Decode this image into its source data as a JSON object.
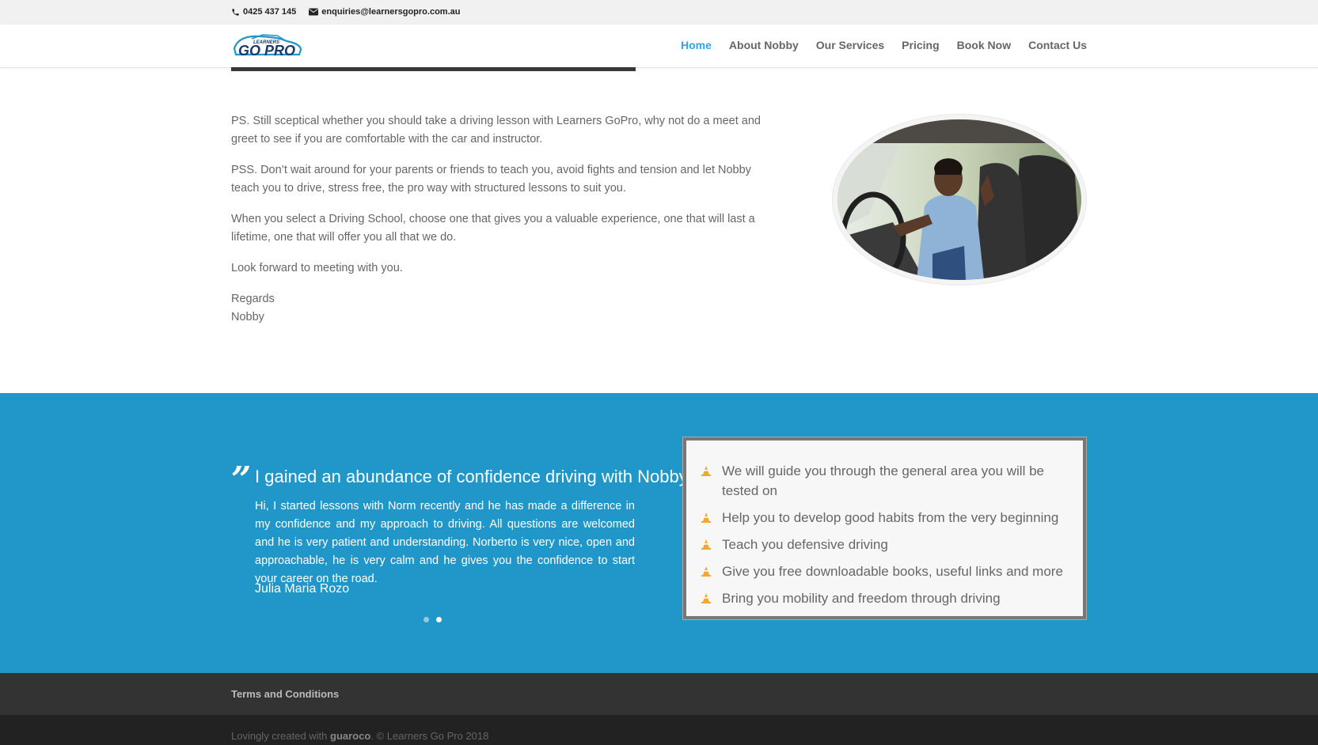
{
  "topbar": {
    "phone": "0425 437 145",
    "email": "enquiries@learnersgopro.com.au"
  },
  "logo": {
    "top_text": "LEARNERS",
    "main_text": "GO PRO"
  },
  "nav": {
    "items": [
      "Home",
      "About Nobby",
      "Our Services",
      "Pricing",
      "Book Now",
      "Contact Us"
    ],
    "active": "Home"
  },
  "content": {
    "p1": "PS. Still sceptical whether you should take a driving lesson with Learners GoPro, why not do a meet and greet to see if you are comfortable with the car and instructor.",
    "p2": "PSS. Don’t wait around for your parents or friends to teach you, avoid fights and tension and let Nobby teach you to drive, stress free, the pro way with structured lessons to suit you.",
    "p3": "When you select a Driving School, choose one that gives you a valuable experience, one that will last a lifetime, one that will offer you all that we do.",
    "p4": "Look forward to meeting with you.",
    "regards": "Regards",
    "name": "Nobby"
  },
  "testimonial": {
    "quote_mark": "”",
    "title": "I gained an abundance of confidence driving with Nobby",
    "body": "Hi, I started lessons with Norm recently and he has made a difference in my confidence and my approach to driving. All questions are welcomed and he is very patient and understanding. Norberto is very nice, open and approachable, he is very calm and he gives you the confidence to start your career on the road.",
    "author": "Julia Maria Rozo",
    "slides": 2,
    "active_slide": 2
  },
  "features": {
    "items": [
      "We will guide you through the general area you will be tested on",
      "Help you to develop good habits from the very beginning",
      "Teach you defensive driving",
      "Give you free downloadable books, useful links and more",
      "Bring you mobility and freedom through driving"
    ]
  },
  "footer": {
    "terms": "Terms and Conditions",
    "credit_prefix": "Lovingly created with ",
    "credit_brand": "guaroco",
    "credit_suffix": ". © Learners Go Pro 2018"
  },
  "colors": {
    "accent": "#2ea3f2",
    "blue_band": "#2196c9",
    "cone": "#f0a830"
  }
}
